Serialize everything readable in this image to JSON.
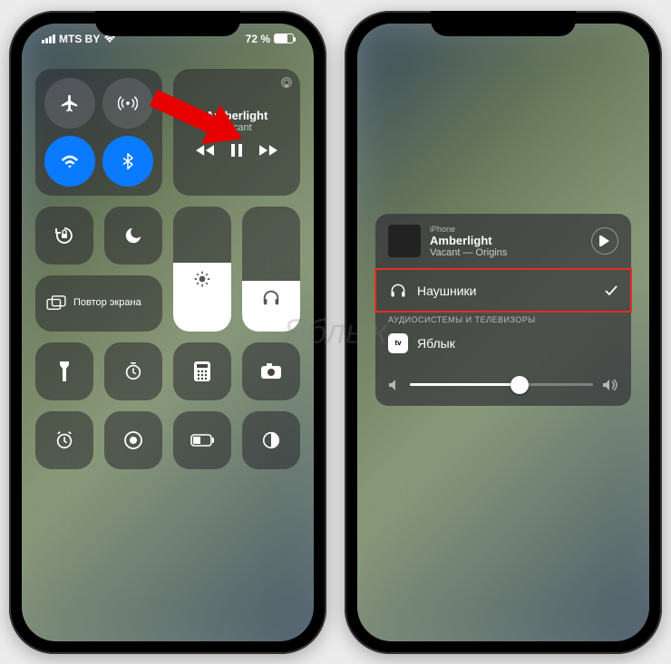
{
  "status": {
    "carrier": "MTS BY",
    "battery_pct": "72 %"
  },
  "music": {
    "title": "Amberlight",
    "artist": "Vacant"
  },
  "mirror_label": "Повтор экрана",
  "airplay": {
    "source": "iPhone",
    "title": "Amberlight",
    "subtitle": "Vacant — Origins",
    "headphones_label": "Наушники",
    "section_label": "АУДИОСИСТЕМЫ И ТЕЛЕВИЗОРЫ",
    "tv_icon_text": "tv",
    "tv_label": "Яблык"
  },
  "watermark": "Яблык"
}
